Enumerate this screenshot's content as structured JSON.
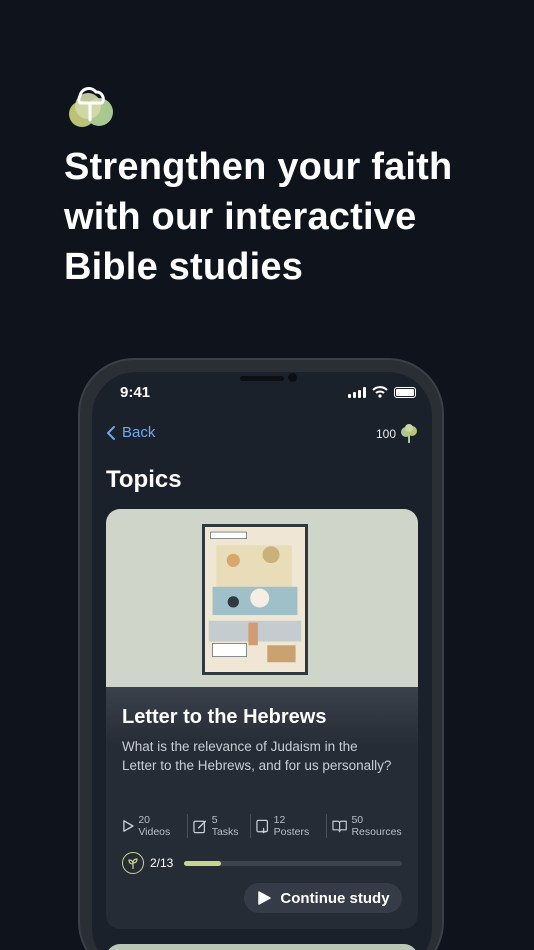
{
  "headline": {
    "line1": "Strengthen your faith",
    "line2": "with our interactive",
    "line3": "Bible studies"
  },
  "status_bar": {
    "time": "9:41"
  },
  "nav": {
    "back_label": "Back",
    "score": "100"
  },
  "section_title": "Topics",
  "topic_card": {
    "title": "Letter to the Hebrews",
    "description": "What is the relevance of Judaism in the Letter to the Hebrews, and for us personally?",
    "stats": {
      "videos": "20 Videos",
      "tasks": "5 Tasks",
      "posters": "12 Posters",
      "resources": "50 Resources"
    },
    "progress_text": "2/13",
    "progress_fraction": 0.17,
    "continue_label": "Continue study"
  },
  "icons": [
    "tree-logo-icon",
    "chevron-left-icon",
    "tree-icon",
    "play-icon",
    "edit-icon",
    "poster-icon",
    "book-icon",
    "sprout-icon"
  ],
  "colors": {
    "accent": "#c7d68a",
    "link": "#6fa9ef",
    "background": "#0f141c"
  }
}
